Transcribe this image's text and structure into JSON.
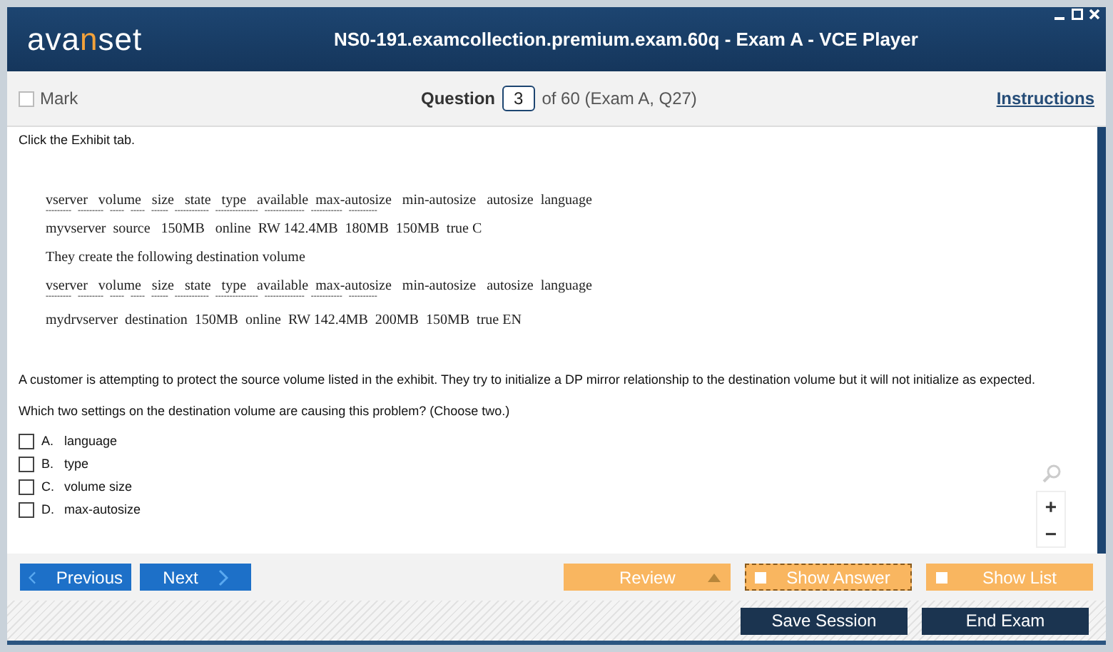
{
  "window": {
    "title": "NS0-191.examcollection.premium.exam.60q - Exam A - VCE Player"
  },
  "logo": [
    {
      "text": "ava",
      "accent": false
    },
    {
      "text": "n",
      "accent": true
    },
    {
      "text": "set",
      "accent": false
    }
  ],
  "toolbar": {
    "mark": {
      "label": "Mark",
      "checked": false
    },
    "question_label": "Question",
    "question_number": "3",
    "question_total": "of 60 (Exam A, Q27)",
    "instructions": "Instructions"
  },
  "question": {
    "intro": "Click the Exhibit tab.",
    "exhibit": [
      {
        "kind": "header",
        "text": "vserver   volume   size   state   type   available  max-autosize   min-autosize   autosize  language"
      },
      {
        "kind": "dashes",
        "text": "---------   ---------   -----   -----   ------   ------------   ---------------   --------------   -----------   ----------"
      },
      {
        "kind": "row",
        "text": "myvserver  source   150MB   online  RW 142.4MB  180MB  150MB  true C"
      },
      {
        "kind": "text",
        "text": "They create the following destination volume"
      },
      {
        "kind": "header",
        "text": "vserver   volume   size   state   type   available  max-autosize   min-autosize   autosize  language"
      },
      {
        "kind": "dashes",
        "text": "---------   ---------   -----   -----   ------   ------------   ---------------   --------------   -----------   ----------"
      },
      {
        "kind": "gap_row",
        "text": "mydrvserver  destination  150MB  online  RW 142.4MB  200MB  150MB  true EN"
      }
    ],
    "body": "A customer is attempting to protect the source volume listed in the exhibit. They try to initialize a DP mirror relationship to the destination volume but it will not initialize as expected.",
    "prompt": "Which two settings on the destination volume are causing this problem? (Choose two.)",
    "options": [
      {
        "letter": "A.",
        "text": "language",
        "checked": false
      },
      {
        "letter": "B.",
        "text": "type",
        "checked": false
      },
      {
        "letter": "C.",
        "text": "volume size",
        "checked": false
      },
      {
        "letter": "D.",
        "text": "max-autosize",
        "checked": false
      }
    ]
  },
  "zoom": {
    "plus": "+",
    "minus": "−"
  },
  "nav": {
    "previous": "Previous",
    "next": "Next",
    "review": "Review",
    "show_answer": {
      "label": "Show Answer",
      "checked": false,
      "focused": true
    },
    "show_list": {
      "label": "Show List",
      "checked": false,
      "focused": false
    }
  },
  "footer": {
    "save": "Save Session",
    "end": "End Exam"
  }
}
